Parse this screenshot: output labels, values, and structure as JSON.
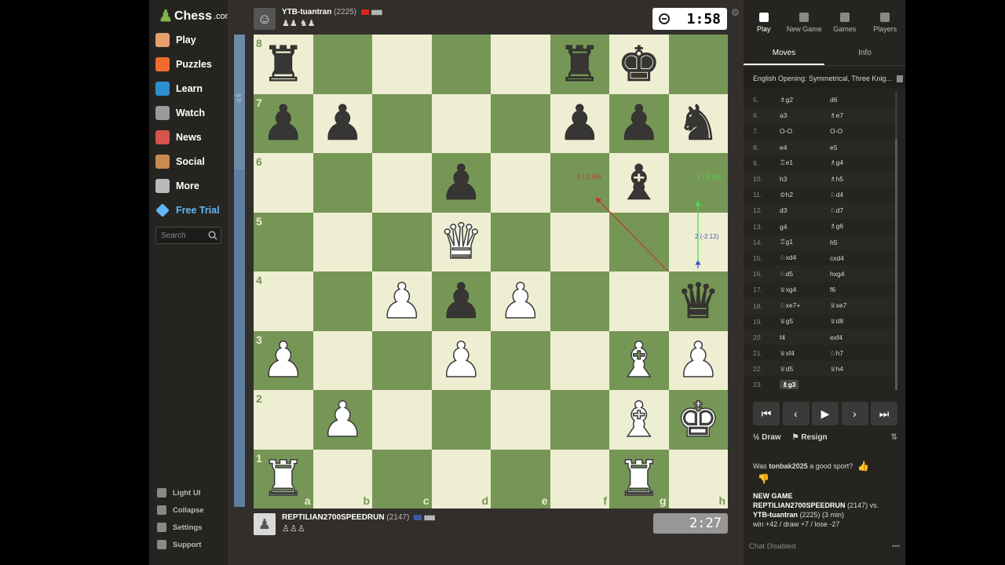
{
  "brand": {
    "name": "Chess",
    "suffix": ".com"
  },
  "nav": [
    {
      "label": "Play",
      "icon": "play-pawn-icon",
      "color": "#e8a06a"
    },
    {
      "label": "Puzzles",
      "icon": "puzzle-icon",
      "color": "#f26c2e"
    },
    {
      "label": "Learn",
      "icon": "learn-icon",
      "color": "#2c8fd0"
    },
    {
      "label": "Watch",
      "icon": "binoculars-icon",
      "color": "#9a9a9a"
    },
    {
      "label": "News",
      "icon": "news-icon",
      "color": "#d8534e"
    },
    {
      "label": "Social",
      "icon": "social-icon",
      "color": "#c98a52"
    },
    {
      "label": "More",
      "icon": "more-dots-icon",
      "color": "#bababa"
    }
  ],
  "trial": {
    "label": "Free Trial",
    "icon": "diamond-icon"
  },
  "search": {
    "placeholder": "Search"
  },
  "bottom_nav": [
    {
      "label": "Light UI",
      "icon": "light-ui-icon"
    },
    {
      "label": "Collapse",
      "icon": "collapse-icon"
    },
    {
      "label": "Settings",
      "icon": "settings-icon"
    },
    {
      "label": "Support",
      "icon": "support-icon"
    }
  ],
  "top_player": {
    "name": "YTB-tuantran",
    "rating": "(2225)",
    "flag_color": "#da251d",
    "captured": "♟♟ ♞♟",
    "clock": "1:58"
  },
  "bottom_player": {
    "name": "REPTILIAN2700SPEEDRUN",
    "rating": "(2147)",
    "flag_color": "#3c5aa6",
    "captured": "♙♙♙",
    "clock": "2:27"
  },
  "board": {
    "files": [
      "a",
      "b",
      "c",
      "d",
      "e",
      "f",
      "g",
      "h"
    ],
    "ranks": [
      "8",
      "7",
      "6",
      "5",
      "4",
      "3",
      "2",
      "1"
    ],
    "position": [
      [
        "br",
        "",
        "",
        "",
        "",
        "br",
        "bk",
        ""
      ],
      [
        "bp",
        "bp",
        "",
        "",
        "",
        "bp",
        "bp",
        "bn"
      ],
      [
        "",
        "",
        "",
        "bp",
        "",
        "",
        "bb",
        ""
      ],
      [
        "",
        "",
        "",
        "wq",
        "",
        "",
        "",
        ""
      ],
      [
        "",
        "",
        "wp",
        "bp",
        "wp",
        "",
        "",
        "bq"
      ],
      [
        "wp",
        "",
        "",
        "wp",
        "",
        "",
        "wb",
        "wp"
      ],
      [
        "",
        "wp",
        "",
        "",
        "",
        "",
        "wb",
        "wk"
      ],
      [
        "wr",
        "",
        "",
        "",
        "",
        "",
        "wr",
        ""
      ]
    ],
    "arrow_labels": {
      "red": "3 (-2.55)",
      "blue": "2 (-2.12)",
      "green": "1 (-2.05)"
    }
  },
  "eval": {
    "score": "-2.5"
  },
  "right_tabs": [
    {
      "label": "Play",
      "icon": "lightning-icon",
      "active": true
    },
    {
      "label": "New Game",
      "icon": "plus-icon",
      "active": false
    },
    {
      "label": "Games",
      "icon": "games-icon",
      "active": false
    },
    {
      "label": "Players",
      "icon": "players-icon",
      "active": false
    }
  ],
  "sub_tabs": [
    "Moves",
    "Info"
  ],
  "opening": "English Opening: Symmetrical, Three Knig...",
  "moves": [
    {
      "n": "5.",
      "w": "♗g2",
      "b": "d6"
    },
    {
      "n": "6.",
      "w": "a3",
      "b": "♗e7"
    },
    {
      "n": "7.",
      "w": "O-O",
      "b": "O-O"
    },
    {
      "n": "8.",
      "w": "e4",
      "b": "e5"
    },
    {
      "n": "9.",
      "w": "♖e1",
      "b": "♗g4"
    },
    {
      "n": "10.",
      "w": "h3",
      "b": "♗h5"
    },
    {
      "n": "11.",
      "w": "♔h2",
      "b": "♘d4"
    },
    {
      "n": "12.",
      "w": "d3",
      "b": "♘d7"
    },
    {
      "n": "13.",
      "w": "g4",
      "b": "♗g6"
    },
    {
      "n": "14.",
      "w": "♖g1",
      "b": "h5"
    },
    {
      "n": "15.",
      "w": "♘xd4",
      "b": "cxd4"
    },
    {
      "n": "16.",
      "w": "♘d5",
      "b": "hxg4"
    },
    {
      "n": "17.",
      "w": "♕xg4",
      "b": "f6"
    },
    {
      "n": "18.",
      "w": "♘xe7+",
      "b": "♕xe7"
    },
    {
      "n": "19.",
      "w": "♕g5",
      "b": "♕d8"
    },
    {
      "n": "20.",
      "w": "f4",
      "b": "exf4"
    },
    {
      "n": "21.",
      "w": "♕xf4",
      "b": "♘h7"
    },
    {
      "n": "22.",
      "w": "♕d5",
      "b": "♕h4"
    },
    {
      "n": "23.",
      "w": "♗g3",
      "b": ""
    }
  ],
  "controls": [
    "⏮",
    "‹",
    "▶",
    "›",
    "⏭"
  ],
  "actions": {
    "draw": "Draw",
    "draw_icon": "½",
    "resign": "Resign",
    "resign_icon": "⚑",
    "flip_icon": "⇅"
  },
  "sport": {
    "prefix": "Was",
    "user": "tonbak2025",
    "suffix": "a good sport?"
  },
  "game_info": {
    "title": "NEW GAME",
    "white": "REPTILIAN2700SPEEDRUN",
    "white_rating": "(2147) vs.",
    "black": "YTB-tuantran",
    "black_rating": "(2225) (3 min)",
    "result": "win +42 / draw +7 / lose -27"
  },
  "chat": {
    "label": "Chat Disabled",
    "menu": "•••"
  }
}
